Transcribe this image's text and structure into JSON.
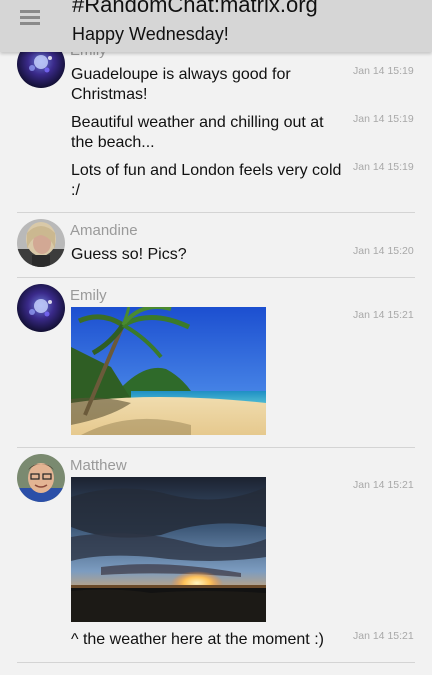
{
  "room": {
    "title": "#RandomChat:matrix.org",
    "topic": "Happy Wednesday!"
  },
  "messages": [
    {
      "sender": "Emily",
      "body": "Guadeloupe is always good for Christmas!",
      "time": "Jan 14 15:19"
    },
    {
      "body": "Beautiful weather and chilling out at the beach...",
      "time": "Jan 14 15:19"
    },
    {
      "body": "Lots of fun and London feels very cold :/",
      "time": "Jan 14 15:19"
    },
    {
      "sender": "Amandine",
      "body": "Guess so! Pics?",
      "time": "Jan 14 15:20"
    },
    {
      "sender": "Emily",
      "image": "beach-photo",
      "time": "Jan 14 15:21"
    },
    {
      "sender": "Matthew",
      "image": "sunset-photo",
      "time": "Jan 14 15:21"
    },
    {
      "body": "^ the weather here at the moment :)",
      "time": "Jan 14 15:21"
    }
  ],
  "icons": {
    "menu": "hamburger-menu-icon"
  },
  "colors": {
    "header_bg": "#d6d6d6",
    "background": "#f2f2f2",
    "sender_name": "#9a9a9a",
    "timestamp": "#a8a8a8",
    "divider": "#d4d4d4"
  }
}
